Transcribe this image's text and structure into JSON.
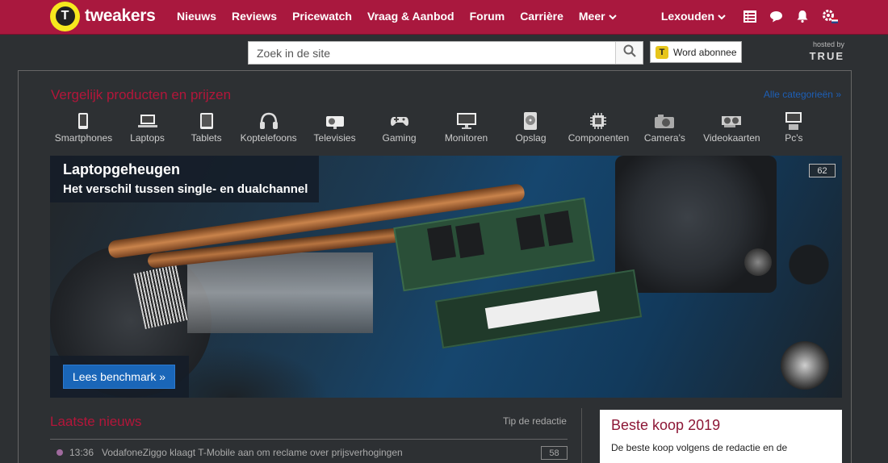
{
  "brand": {
    "logo_letter": "T",
    "name": "tweakers"
  },
  "nav": {
    "items": [
      {
        "label": "Nieuws"
      },
      {
        "label": "Reviews"
      },
      {
        "label": "Pricewatch"
      },
      {
        "label": "Vraag & Aanbod"
      },
      {
        "label": "Forum"
      },
      {
        "label": "Carrière"
      },
      {
        "label": "Meer"
      }
    ],
    "user": "Lexouden",
    "icons": [
      "list-icon",
      "chat-icon",
      "bell-icon",
      "gear-icon"
    ]
  },
  "search": {
    "placeholder": "Zoek in de site"
  },
  "subscribe": {
    "badge": "T",
    "label": "Word abonnee"
  },
  "hosted": {
    "label": "hosted by",
    "brand": "TRUE"
  },
  "compare": {
    "title": "Vergelijk producten en prijzen",
    "link": "Alle categorieën »",
    "categories": [
      {
        "label": "Smartphones",
        "icon": "smartphone-icon"
      },
      {
        "label": "Laptops",
        "icon": "laptop-icon"
      },
      {
        "label": "Tablets",
        "icon": "tablet-icon"
      },
      {
        "label": "Koptelefoons",
        "icon": "headphones-icon"
      },
      {
        "label": "Televisies",
        "icon": "tv-icon"
      },
      {
        "label": "Gaming",
        "icon": "gamepad-icon"
      },
      {
        "label": "Monitoren",
        "icon": "monitor-icon"
      },
      {
        "label": "Opslag",
        "icon": "harddisk-icon"
      },
      {
        "label": "Componenten",
        "icon": "cpu-icon"
      },
      {
        "label": "Camera's",
        "icon": "camera-icon"
      },
      {
        "label": "Videokaarten",
        "icon": "gpu-icon"
      },
      {
        "label": "Pc's",
        "icon": "pc-icon"
      }
    ]
  },
  "hero": {
    "title": "Laptopgeheugen",
    "subtitle": "Het verschil tussen single- en dualchannel",
    "comments": "62",
    "cta": "Lees benchmark »"
  },
  "news": {
    "title": "Laatste nieuws",
    "tip": "Tip de redactie",
    "items": [
      {
        "time": "13:36",
        "text": "VodafoneZiggo klaagt T-Mobile aan om reclame over prijsverhogingen",
        "comments": "58"
      }
    ]
  },
  "best_buy": {
    "title": "Beste koop 2019",
    "text": "De beste koop volgens de redactie en de"
  },
  "colors": {
    "brand": "#a9183e",
    "accent_red": "#b3163a",
    "link_blue": "#1d5fb6",
    "cta_blue": "#1a66b8",
    "logo_yellow": "#f6e81e"
  }
}
